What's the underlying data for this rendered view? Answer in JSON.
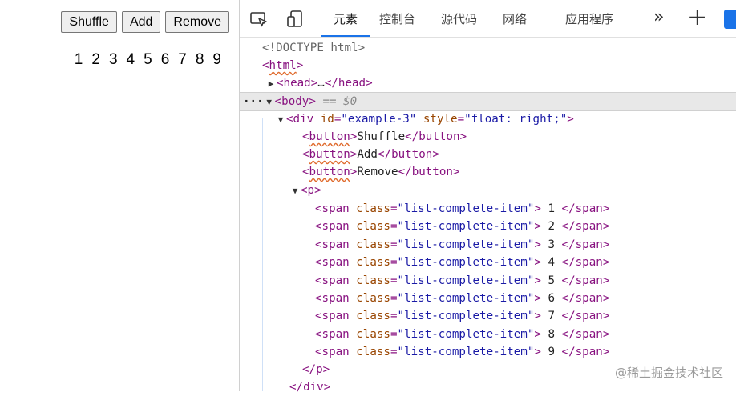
{
  "preview": {
    "buttons": [
      "Shuffle",
      "Add",
      "Remove"
    ],
    "numbers": [
      "1",
      "2",
      "3",
      "4",
      "5",
      "6",
      "7",
      "8",
      "9"
    ]
  },
  "devtools": {
    "tabs": [
      "元素",
      "控制台",
      "源代码",
      "网络",
      "应用程序"
    ],
    "active_tab": "元素",
    "more_tabs_label": "»",
    "add_tab_label": "+",
    "accent_color": "#1a73e8"
  },
  "dom": {
    "doctype": "<!DOCTYPE html>",
    "html_tag": "html",
    "head_tag": "head",
    "ellipsis": "…",
    "body_tag": "body",
    "selected_note": "== $0",
    "div_tag": "div",
    "div_attrs": [
      {
        "name": "id",
        "value": "\"example-3\""
      },
      {
        "name": "style",
        "value": "\"float: right;\""
      }
    ],
    "button_tag": "button",
    "button_texts": [
      "Shuffle",
      "Add",
      "Remove"
    ],
    "p_tag": "p",
    "span_tag": "span",
    "span_class_attr": "class",
    "span_class_value": "\"list-complete-item\"",
    "span_texts": [
      " 1 ",
      " 2 ",
      " 3 ",
      " 4 ",
      " 5 ",
      " 6 ",
      " 7 ",
      " 8 ",
      " 9 "
    ],
    "close_p": "</p>",
    "close_div": "</div>"
  },
  "watermark": "@稀土掘金技术社区"
}
